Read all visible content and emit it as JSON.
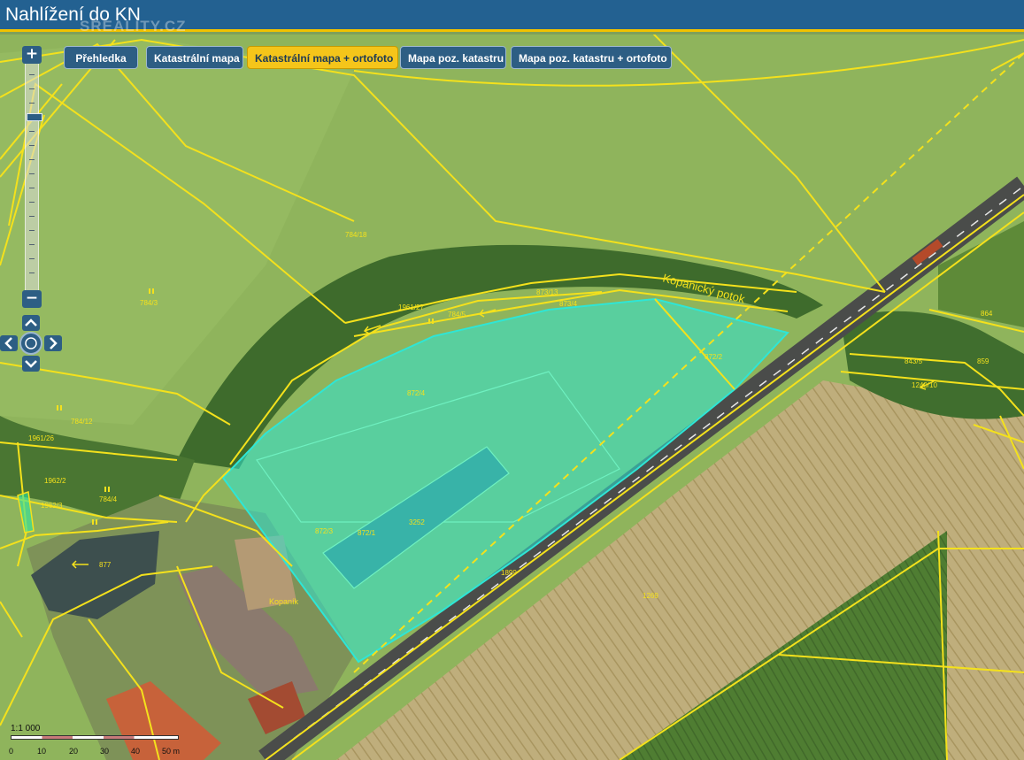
{
  "window": {
    "title": "Nahlížení do KN",
    "watermark": "SREALITY.CZ"
  },
  "tabs": [
    {
      "label": "Přehledka",
      "active": false
    },
    {
      "label": "Katastrální mapa",
      "active": false
    },
    {
      "label": "Katastrální mapa + ortofoto",
      "active": true
    },
    {
      "label": "Mapa poz. katastru",
      "active": false
    },
    {
      "label": "Mapa poz. katastru + ortofoto",
      "active": false
    }
  ],
  "zoom": {
    "plus": "+",
    "minus": "−"
  },
  "map": {
    "labels": {
      "p784_18": "784/18",
      "p784_3": "784/3",
      "p784_12": "784/12",
      "p784_4": "784/4",
      "p1961_27": "1961/27",
      "p1961_26": "1961/26",
      "p1962_2": "1962/2",
      "p1962_3": "1962/3",
      "p784_5": "784/5",
      "p873_13": "873/13",
      "p873_4": "873/4",
      "p872_4": "872/4",
      "p872_2": "872/2",
      "p872_3": "872/3",
      "p872_1": "872/1",
      "p3252": "3252",
      "p1899": "1899",
      "p877": "877",
      "p864": "864",
      "p843_5": "843/5",
      "p859": "859",
      "p1240_10": "1240/10",
      "p1269": "1269",
      "stream": "Kopanický potok",
      "place": "Kopaník"
    },
    "colors": {
      "parcel_line": "#f4e11c",
      "selection_fill": "#2ee6d6",
      "field": "#8fb45c",
      "forest": "#3e6b2c",
      "road": "#4a4c4a"
    }
  },
  "scale": {
    "ratio": "1:1 000",
    "ticks": [
      "0",
      "10",
      "20",
      "30",
      "40",
      "50 m"
    ]
  }
}
